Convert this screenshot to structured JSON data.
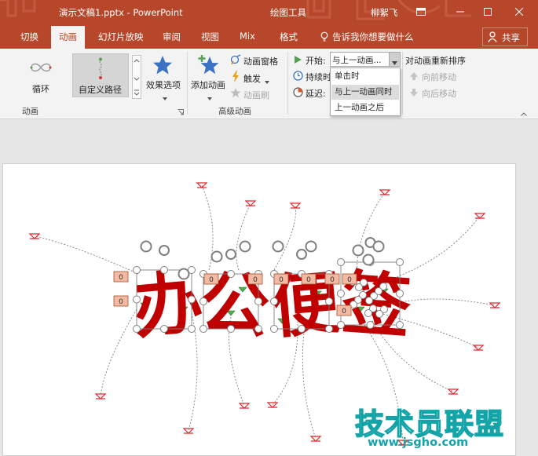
{
  "window": {
    "title": "演示文稿1.pptx - PowerPoint",
    "context_tool": "绘图工具",
    "user": "柳絮飞",
    "controls": [
      "ribbon-display-icon",
      "minimize-icon",
      "maximize-icon",
      "close-icon"
    ]
  },
  "tabs": [
    "切换",
    "动画",
    "幻灯片放映",
    "审阅",
    "视图",
    "Mix",
    "格式"
  ],
  "active_tab": "动画",
  "tell_me": "告诉我你想要做什么",
  "share": "共享",
  "ribbon": {
    "animation_group": {
      "label": "动画",
      "items": [
        {
          "label": "循环",
          "icon": "loop-icon",
          "selected": false
        },
        {
          "label": "自定义路径",
          "icon": "custom-path-icon",
          "selected": true
        }
      ]
    },
    "effect_options": "效果选项",
    "advanced_group": {
      "label": "高级动画",
      "add_animation": "添加动画",
      "pane": "动画窗格",
      "trigger": "触发",
      "painter": "动画刷"
    },
    "timing": {
      "start_label": "开始:",
      "start_value": "与上一动画...",
      "duration_label": "持续时",
      "delay_label": "延迟:",
      "reorder": "对动画重新排序",
      "move_earlier": "向前移动",
      "move_later": "向后移动"
    }
  },
  "start_dropdown": {
    "options": [
      "单击时",
      "与上一动画同时",
      "上一动画之后"
    ],
    "selected": "与上一动画同时"
  },
  "slide": {
    "text": "办公便签",
    "text_color": "#c00000",
    "badge": "0"
  },
  "watermark": {
    "main": "技术员联盟",
    "url": "www.jsgho.com"
  },
  "colors": {
    "ribbon_accent": "#b7472a",
    "path_marker": "#e0282e",
    "watermark": "#13a4a8"
  }
}
